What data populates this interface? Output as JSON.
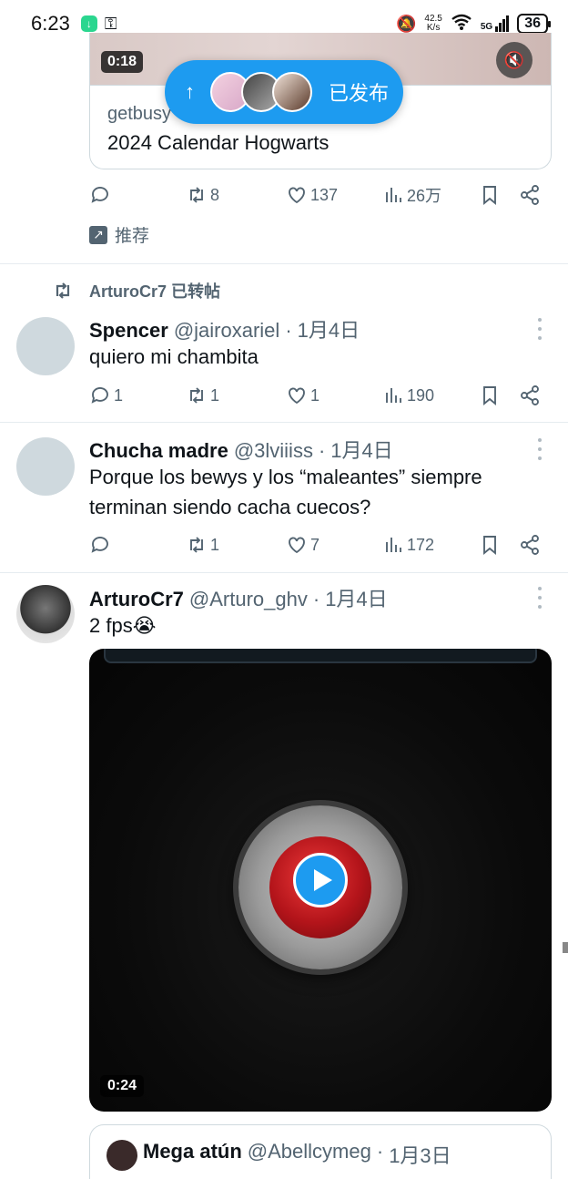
{
  "status_bar": {
    "time": "6:23",
    "network_speed_value": "42.5",
    "network_speed_unit": "K/s",
    "signal_label": "5G",
    "battery": "36"
  },
  "top_tweet": {
    "media_duration": "0:18",
    "card_domain": "getbusy",
    "card_title": "2024 Calendar Hogwarts",
    "retweets": "8",
    "likes": "137",
    "views": "26万",
    "promoted_label": "推荐"
  },
  "posted_pill": {
    "label": "已发布"
  },
  "retweet_context": {
    "text": "ArturoCr7 已转帖"
  },
  "tweets": [
    {
      "name": "Spencer",
      "handle": "@jairoxariel",
      "separator": "·",
      "date": "1月4日",
      "text": "quiero mi chambita",
      "replies": "1",
      "retweets": "1",
      "likes": "1",
      "views": "190"
    },
    {
      "name": "Chucha madre",
      "handle": "@3lviiiss",
      "separator": "·",
      "date": "1月4日",
      "text": "Porque los bewys y los “maleantes” siempre terminan siendo cacha cuecos?",
      "replies": "",
      "retweets": "1",
      "likes": "7",
      "views": "172"
    },
    {
      "name": "ArturoCr7",
      "handle": "@Arturo_ghv",
      "separator": "·",
      "date": "1月4日",
      "text": "2 fps😭",
      "video_duration": "0:24"
    }
  ],
  "quote": {
    "name": "Mega atún",
    "handle": "@Abellcymeg",
    "separator": "·",
    "date": "1月3日"
  },
  "colors": {
    "accent": "#1d9bf0",
    "secondary_text": "#536471",
    "primary_text": "#0f1419",
    "divider": "#e6ecf0"
  }
}
